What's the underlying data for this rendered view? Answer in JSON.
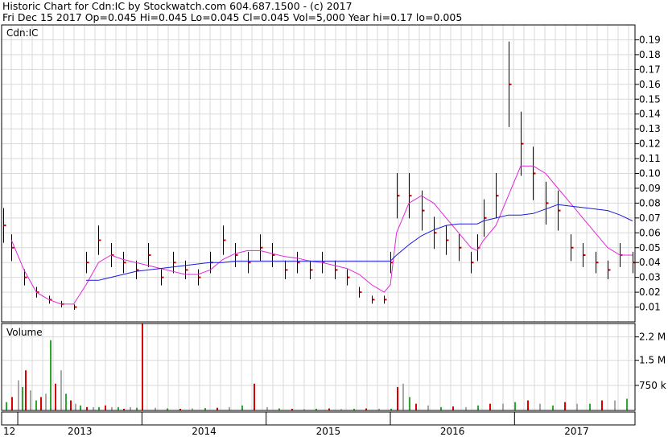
{
  "header": {
    "line1": "Historic Chart for Cdn:IC by Stockwatch.com 604.687.1500 - (c) 2017",
    "line2": "Fri Dec 15 2017   Op=0.045   Hi=0.045   Lo=0.045   Cl=0.045   Vol=5,000   Year hi=0.17   lo=0.005"
  },
  "chart_data": [
    {
      "type": "line",
      "title": "Cdn:IC",
      "ylim": [
        0.0,
        0.2
      ],
      "y_ticks": [
        "0.19",
        "0.18",
        "0.17",
        "0.16",
        "0.15",
        "0.14",
        "0.13",
        "0.12",
        "0.11",
        "0.10",
        "0.09",
        "0.08",
        "0.07",
        "0.06",
        "0.05",
        "0.04",
        "0.03",
        "0.02",
        "0.01"
      ],
      "x_ticks": [
        "12",
        "2013",
        "2014",
        "2015",
        "2016",
        "2017"
      ],
      "grid": true,
      "x": [
        2012.88,
        2012.95,
        2013.05,
        2013.15,
        2013.25,
        2013.35,
        2013.45,
        2013.55,
        2013.65,
        2013.75,
        2013.85,
        2013.95,
        2014.05,
        2014.15,
        2014.25,
        2014.35,
        2014.45,
        2014.55,
        2014.65,
        2014.75,
        2014.85,
        2014.95,
        2015.05,
        2015.15,
        2015.25,
        2015.35,
        2015.45,
        2015.55,
        2015.65,
        2015.75,
        2015.85,
        2015.95,
        2016.0,
        2016.05,
        2016.15,
        2016.25,
        2016.35,
        2016.45,
        2016.55,
        2016.65,
        2016.7,
        2016.75,
        2016.85,
        2016.95,
        2017.05,
        2017.15,
        2017.25,
        2017.35,
        2017.45,
        2017.55,
        2017.65,
        2017.75,
        2017.85,
        2017.95
      ],
      "series": [
        {
          "values": [
            0.065,
            0.05,
            0.03,
            0.02,
            0.015,
            0.012,
            0.01,
            0.04,
            0.055,
            0.045,
            0.04,
            0.035,
            0.045,
            0.03,
            0.04,
            0.035,
            0.03,
            0.04,
            0.055,
            0.045,
            0.04,
            0.05,
            0.045,
            0.035,
            0.04,
            0.035,
            0.04,
            0.035,
            0.03,
            0.02,
            0.015,
            0.015,
            0.04,
            0.085,
            0.085,
            0.075,
            0.06,
            0.055,
            0.05,
            0.04,
            0.05,
            0.07,
            0.085,
            0.16,
            0.12,
            0.1,
            0.08,
            0.075,
            0.05,
            0.045,
            0.04,
            0.035,
            0.045,
            0.04
          ]
        },
        {
          "values": [
            null,
            0.055,
            0.035,
            0.02,
            0.015,
            0.012,
            0.012,
            0.025,
            0.04,
            0.045,
            0.042,
            0.04,
            0.038,
            0.036,
            0.034,
            0.032,
            0.032,
            0.035,
            0.042,
            0.046,
            0.048,
            0.048,
            0.046,
            0.044,
            0.043,
            0.041,
            0.04,
            0.038,
            0.036,
            0.032,
            0.025,
            0.02,
            0.025,
            0.06,
            0.08,
            0.085,
            0.08,
            0.07,
            0.06,
            0.05,
            0.048,
            0.055,
            0.065,
            0.085,
            0.105,
            0.105,
            0.1,
            0.09,
            0.08,
            0.07,
            0.06,
            0.05,
            0.045,
            0.045
          ]
        },
        {
          "values": [
            null,
            null,
            null,
            null,
            null,
            null,
            null,
            0.028,
            0.028,
            0.03,
            0.032,
            0.034,
            0.035,
            0.036,
            0.037,
            0.038,
            0.039,
            0.04,
            0.04,
            0.041,
            0.041,
            0.041,
            0.041,
            0.041,
            0.041,
            0.041,
            0.041,
            0.041,
            0.041,
            0.041,
            0.041,
            0.041,
            0.041,
            0.045,
            0.052,
            0.058,
            0.062,
            0.065,
            0.066,
            0.066,
            0.066,
            0.068,
            0.07,
            0.072,
            0.072,
            0.073,
            0.076,
            0.079,
            0.078,
            0.077,
            0.076,
            0.075,
            0.072,
            0.068
          ]
        }
      ]
    },
    {
      "type": "bar",
      "title": "Volume",
      "y_ticks": [
        "2.2 M",
        "1.5 M",
        "750 k"
      ],
      "ylim": [
        0,
        2600000
      ],
      "grid": true,
      "x": [
        2012.9,
        2012.95,
        2013.0,
        2013.03,
        2013.06,
        2013.1,
        2013.14,
        2013.18,
        2013.22,
        2013.26,
        2013.3,
        2013.34,
        2013.38,
        2013.42,
        2013.46,
        2013.5,
        2013.55,
        2013.6,
        2013.65,
        2013.7,
        2013.75,
        2013.8,
        2013.85,
        2013.9,
        2013.95,
        2014.0,
        2014.1,
        2014.2,
        2014.3,
        2014.4,
        2014.5,
        2014.6,
        2014.7,
        2014.8,
        2014.9,
        2015.0,
        2015.1,
        2015.2,
        2015.3,
        2015.4,
        2015.5,
        2015.6,
        2015.7,
        2015.8,
        2015.9,
        2016.0,
        2016.05,
        2016.1,
        2016.15,
        2016.2,
        2016.3,
        2016.4,
        2016.5,
        2016.6,
        2016.7,
        2016.8,
        2016.9,
        2017.0,
        2017.1,
        2017.2,
        2017.3,
        2017.4,
        2017.5,
        2017.6,
        2017.7,
        2017.8,
        2017.9
      ],
      "values": [
        250000,
        400000,
        900000,
        700000,
        1200000,
        600000,
        300000,
        400000,
        500000,
        2100000,
        800000,
        1200000,
        500000,
        300000,
        200000,
        150000,
        100000,
        100000,
        100000,
        150000,
        100000,
        100000,
        50000,
        100000,
        80000,
        2600000,
        80000,
        60000,
        50000,
        60000,
        70000,
        80000,
        100000,
        150000,
        800000,
        100000,
        60000,
        50000,
        40000,
        50000,
        60000,
        40000,
        50000,
        60000,
        50000,
        50000,
        700000,
        800000,
        400000,
        200000,
        150000,
        100000,
        120000,
        100000,
        150000,
        200000,
        200000,
        250000,
        300000,
        200000,
        150000,
        250000,
        200000,
        200000,
        300000,
        300000,
        350000
      ],
      "colors": {
        "up": "#2ea82e",
        "down": "#dd0000",
        "flat": "#a8a8a8"
      }
    }
  ]
}
